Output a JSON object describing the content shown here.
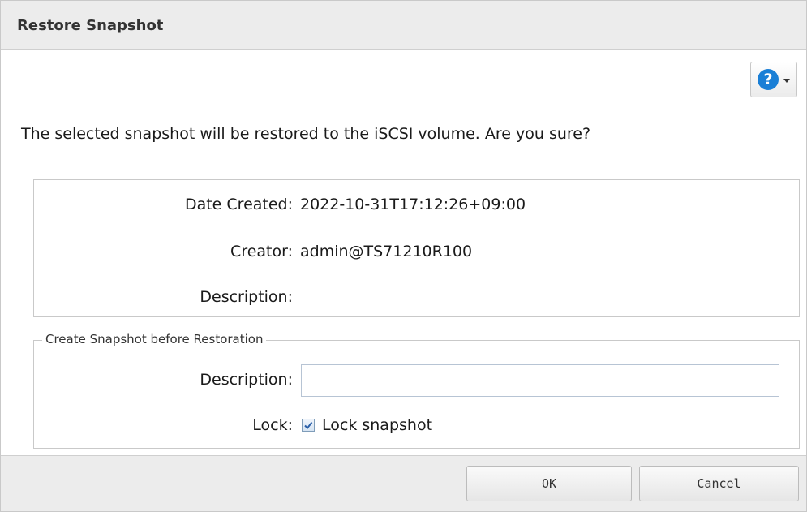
{
  "dialog": {
    "title": "Restore Snapshot",
    "help_icon": "question-circle-icon"
  },
  "message": "The selected snapshot will be restored to the iSCSI volume. Are you sure?",
  "snapshot_info": {
    "date_created_label": "Date Created:",
    "date_created_value": "2022-10-31T17:12:26+09:00",
    "creator_label": "Creator:",
    "creator_value": "admin@TS71210R100",
    "description_label": "Description:",
    "description_value": ""
  },
  "create_snapshot": {
    "legend": "Create Snapshot before Restoration",
    "description_label": "Description:",
    "description_value": "",
    "description_placeholder": "",
    "lock_label": "Lock:",
    "lock_checkbox_label": "Lock snapshot",
    "lock_checked": true
  },
  "footer": {
    "ok_label": "OK",
    "cancel_label": "Cancel"
  },
  "colors": {
    "help_icon": "#1a7fd6",
    "titlebar_bg": "#ececec",
    "checkbox_check": "#2a5fa8"
  }
}
